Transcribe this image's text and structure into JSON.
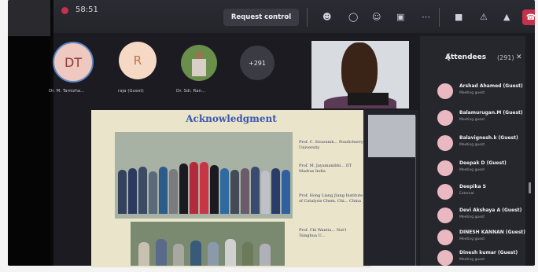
{
  "toolbar": {
    "timer": "58:51",
    "request_control": "Request control",
    "icons": [
      "people-icon",
      "chat-icon",
      "reactions-icon",
      "share-icon",
      "more-icon",
      "camera-icon",
      "mic-off-icon",
      "share-tray-icon",
      "leave-icon"
    ]
  },
  "participants": [
    {
      "initials": "DT",
      "name": "Dr. M. Tamizha..."
    },
    {
      "initials": "R",
      "name": "raja (Guest)"
    },
    {
      "initials": "",
      "name": "Dr. Sdi. Ran..."
    },
    {
      "initials": "+291",
      "name": ""
    }
  ],
  "slide": {
    "title": "Acknowledgment",
    "credits": [
      "Prof. C. Sivaramk… Pondicherry University",
      "Prof. M. Jayamanibhi… IIT Madras India",
      "Prof. Hong Liang Jiang Institute of Catalysis Chem. Chi… China",
      "Prof. Chi Wantia… Nat'l Tsinghua U…"
    ]
  },
  "attendees_panel": {
    "title": "Attendees",
    "count": "(291)",
    "items": [
      {
        "name": "Arshad Ahamed (Guest)",
        "role": "Meeting guest"
      },
      {
        "name": "Balamurugan.M (Guest)",
        "role": "Meeting guest"
      },
      {
        "name": "Balavignesh.k (Guest)",
        "role": "Meeting guest"
      },
      {
        "name": "Deepak D (Guest)",
        "role": "Meeting guest"
      },
      {
        "name": "Deepika S",
        "role": "External"
      },
      {
        "name": "Devi Akshaya A (Guest)",
        "role": "Meeting guest"
      },
      {
        "name": "DINESH KANNAN (Guest)",
        "role": "Meeting guest"
      },
      {
        "name": "Dinesh kumar (Guest)",
        "role": "Meeting guest"
      }
    ]
  }
}
